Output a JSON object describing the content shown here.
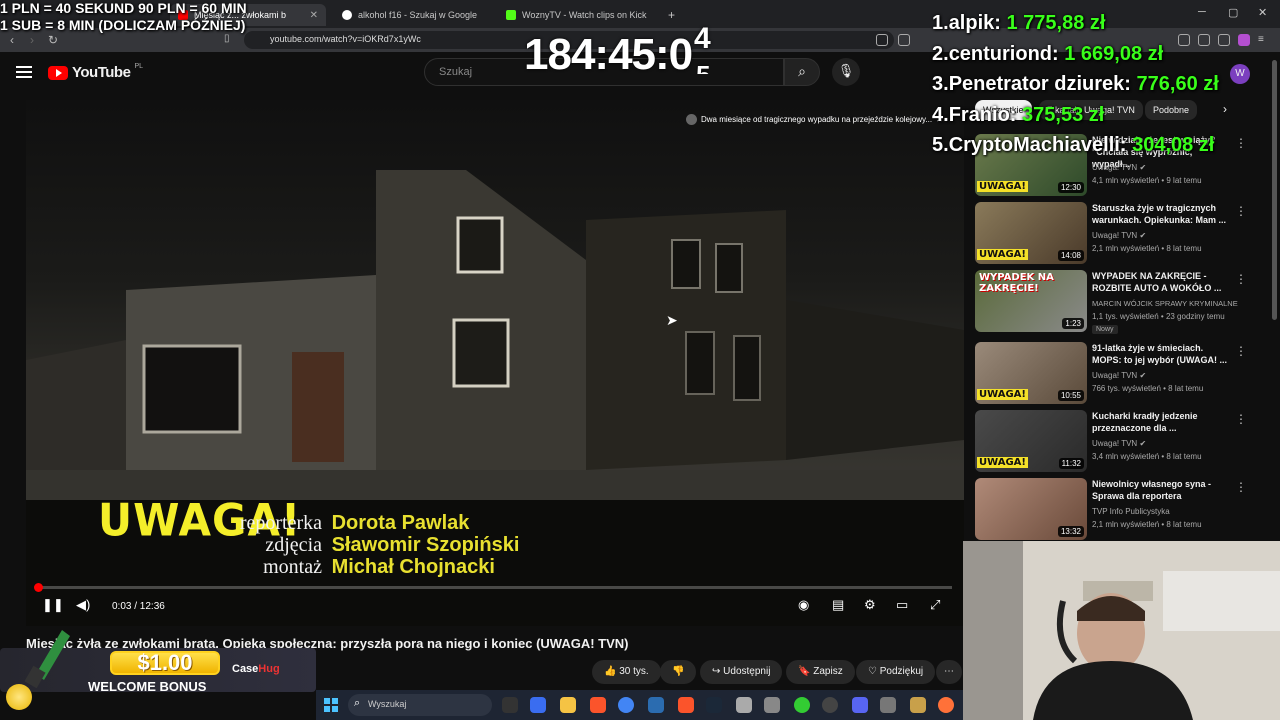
{
  "browser": {
    "tabs": [
      {
        "label": "Miesiąc z... zwłokami b",
        "active": true
      },
      {
        "label": "alkohol f16 - Szukaj w Google",
        "active": false
      },
      {
        "label": "WoznyTV - Watch clips on Kick",
        "active": false
      }
    ],
    "new_tab": "+",
    "url": "youtube.com/watch?v=iOKRd7x1yWc",
    "controls": {
      "minimize": "─",
      "maximize": "▢",
      "close": "✕"
    }
  },
  "youtube": {
    "logo_text": "YouTube",
    "logo_region": "PL",
    "search_placeholder": "Szukaj",
    "avatar_initial": "W"
  },
  "player": {
    "notification": "Dwa miesiące od tragicznego wypadku na przejeździe kolejowy...",
    "uwaga_logo": "UWAGA!",
    "credits": [
      {
        "role": "reporterka",
        "name": "Dorota Pawlak"
      },
      {
        "role": "zdjęcia",
        "name": "Sławomir Szopiński"
      },
      {
        "role": "montaż",
        "name": "Michał Chojnacki"
      }
    ],
    "time": "0:03 / 12:36",
    "progress_fraction": 0.004
  },
  "video": {
    "title": "Miesiąc żyła ze zwłokami brata. Opieka społeczna: przyszła pora na niego i koniec (UWAGA! TVN)",
    "likes": "30 tys.",
    "share": "Udostępnij",
    "save": "Zapisz",
    "thanks": "Podziękuj"
  },
  "sidebar": {
    "chips": [
      "Wszystkie",
      "Z kanału Uwaga! TVN",
      "Podobne"
    ],
    "recommendations": [
      {
        "title": "Nie widziało, że jest w ciąży? \"Chciała się wypróżnić, wypadł...",
        "channel": "Uwaga! TVN",
        "meta": "4,1 mln wyświetleń • 9 lat temu",
        "duration": "12:30",
        "badge": "UWAGA!"
      },
      {
        "title": "Staruszka żyje w tragicznych warunkach. Opiekunka: Mam ...",
        "channel": "Uwaga! TVN",
        "meta": "2,1 mln wyświetleń • 8 lat temu",
        "duration": "14:08",
        "badge": "UWAGA!"
      },
      {
        "title": "WYPADEK NA ZAKRĘCIE - ROZBITE AUTO A WOKÓŁO ...",
        "channel": "MARCIN WÓJCIK SPRAWY KRYMINALNE",
        "meta": "1,1 tys. wyświetleń • 23 godziny temu",
        "duration": "1:23",
        "badge": "WYPADEK NA ZAKRĘCIE!",
        "new": "Nowy"
      },
      {
        "title": "91-latka żyje w śmieciach. MOPS: to jej wybór (UWAGA! ...",
        "channel": "Uwaga! TVN",
        "meta": "766 tys. wyświetleń • 8 lat temu",
        "duration": "10:55",
        "badge": "UWAGA!"
      },
      {
        "title": "Kucharki kradły jedzenie przeznaczone dla ...",
        "channel": "Uwaga! TVN",
        "meta": "3,4 mln wyświetleń • 8 lat temu",
        "duration": "11:32",
        "badge": "UWAGA!"
      },
      {
        "title": "Niewolnicy własnego syna - Sprawa dla reportera",
        "channel": "TVP Info Publicystyka",
        "meta": "2,1 mln wyświetleń • 8 lat temu",
        "duration": "13:32",
        "badge": ""
      }
    ]
  },
  "taskbar": {
    "search_placeholder": "Wyszukaj"
  },
  "overlays": {
    "rates_line1": "1 PLN = 40 SEKUND 90 PLN = 60 MIN",
    "rates_line2": "1 SUB = 8 MIN (DOLICZAM PÓŹNIEJ)",
    "timer": "184:45:0",
    "timer_sup": "4",
    "timer_sub": "5",
    "donors": [
      {
        "rank": "1.",
        "name": "alpik:",
        "amount": "1 775,88 zł"
      },
      {
        "rank": "2.",
        "name": "centuriond:",
        "amount": "1 669,08 zł"
      },
      {
        "rank": "3.",
        "name": "Penetrator dziurek:",
        "amount": "776,60 zł"
      },
      {
        "rank": "4.",
        "name": "Franio:",
        "amount": "375,53 zł"
      },
      {
        "rank": "5.",
        "name": "CryptoMachiavelli:",
        "amount": "304,08 zł"
      }
    ],
    "promo": {
      "amount": "$1.00",
      "text": "WELCOME BONUS",
      "brand_a": "Case",
      "brand_b": "Hug"
    }
  }
}
